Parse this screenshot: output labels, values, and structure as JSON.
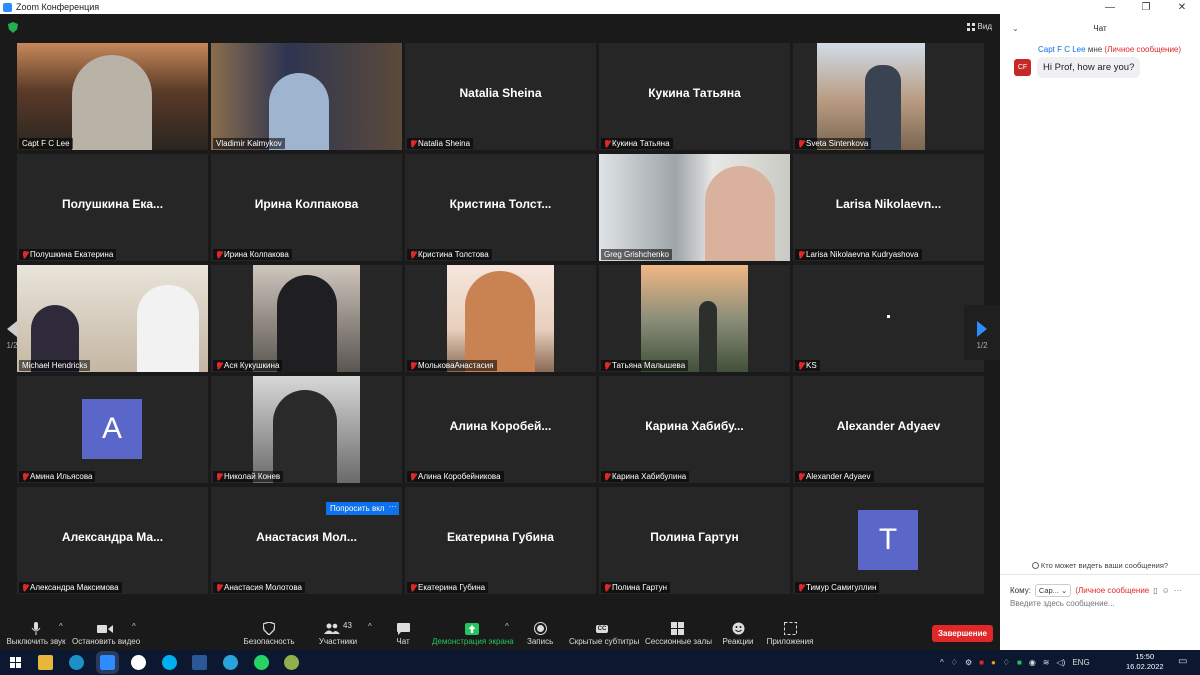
{
  "window": {
    "title": "Zoom Конференция"
  },
  "meeting": {
    "view_label": "Вид",
    "participants": [
      {
        "big": "",
        "label": "Capt F C Lee",
        "muted": false,
        "video": "capt"
      },
      {
        "big": "",
        "label": "Vladimir Kalmykov",
        "muted": false,
        "video": "vlad"
      },
      {
        "big": "Natalia Sheina",
        "label": "Natalia Sheina",
        "muted": true
      },
      {
        "big": "Кукина Татьяна",
        "label": "Кукина Татьяна",
        "muted": true
      },
      {
        "big": "",
        "label": "Sveta Sintenkova",
        "muted": true,
        "video": "sveta"
      },
      {
        "big": "Полушкина Ека...",
        "label": "Полушкина Екатерина",
        "muted": true
      },
      {
        "big": "Ирина Колпакова",
        "label": "Ирина Колпакова",
        "muted": true
      },
      {
        "big": "Кристина Толст...",
        "label": "Кристина Толстова",
        "muted": true
      },
      {
        "big": "",
        "label": "Greg Grishchenko",
        "muted": false,
        "video": "greg",
        "active": true
      },
      {
        "big": "Larisa Nikolaevn...",
        "label": "Larisa Nikolaevna Kudryashova",
        "muted": true
      },
      {
        "big": "",
        "label": "Michael Hendricks",
        "muted": false,
        "video": "michael"
      },
      {
        "big": "",
        "label": "Ася Кукушкина",
        "muted": true,
        "video": "asya"
      },
      {
        "big": "",
        "label": "МольковаАнастасия",
        "muted": true,
        "video": "molkova"
      },
      {
        "big": "",
        "label": "Татьяна Малышева",
        "muted": true,
        "video": "tatiana"
      },
      {
        "big": "",
        "label": "KS",
        "muted": true,
        "video": "ks"
      },
      {
        "big": "",
        "label": "Амина Ильясова",
        "muted": true,
        "avatar": "A"
      },
      {
        "big": "",
        "label": "Николай Конев",
        "muted": true,
        "video": "nikolay"
      },
      {
        "big": "Алина Коробей...",
        "label": "Алина Коробейникова",
        "muted": true
      },
      {
        "big": "Карина Хабибу...",
        "label": "Карина Хабибулина",
        "muted": true
      },
      {
        "big": "Alexander Adyaev",
        "label": "Alexander Adyaev",
        "muted": true
      },
      {
        "big": "Александра Ма...",
        "label": "Александра Максимова",
        "muted": true
      },
      {
        "big": "Анастасия Мол...",
        "label": "Анастасия Молотова",
        "muted": true
      },
      {
        "big": "Екатерина Губина",
        "label": "Екатерина Губина",
        "muted": true
      },
      {
        "big": "Полина Гартун",
        "label": "Полина Гартун",
        "muted": true
      },
      {
        "big": "",
        "label": "Тимур Самигуллин",
        "muted": true,
        "avatar": "T"
      }
    ],
    "ask_button": "Попросить вкл",
    "ask_more": "···",
    "page_left": "1/2",
    "page_right": "1/2"
  },
  "toolbar": {
    "mute": "Выключить звук",
    "video": "Остановить видео",
    "security": "Безопасность",
    "participants": "Участники",
    "participants_count": "43",
    "chat": "Чат",
    "share": "Демонстрация экрана",
    "record": "Запись",
    "captions": "Скрытые субтитры",
    "captions_icon": "CC",
    "breakout": "Сессионные залы",
    "reactions": "Реакции",
    "apps": "Приложения",
    "end": "Завершение"
  },
  "chat": {
    "title": "Чат",
    "from": "Capt F C Lee",
    "to_me": "мне",
    "private": "(Личное сообщение)",
    "avatar_initials": "CF",
    "message": "Hi Prof, how are you?",
    "who_can_see": "Кто может видеть ваши сообщения?",
    "to_label": "Кому:",
    "to_value": "Cap...",
    "to_private": "(Личное сообщение",
    "placeholder": "Введите здесь сообщение..."
  },
  "taskbar": {
    "lang": "ENG",
    "time": "15:50",
    "date": "16.02.2022"
  },
  "colors": {
    "zoom_blue": "#0e72ed",
    "end_red": "#e02828",
    "share_green": "#22c55e",
    "active_speaker": "#a6d63b",
    "avatar_purple": "#5b67c8"
  }
}
